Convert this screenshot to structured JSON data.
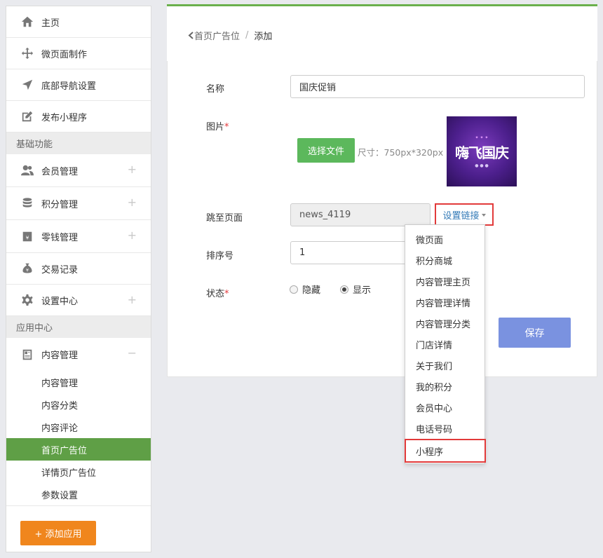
{
  "sidebar": {
    "items": [
      {
        "label": "主页",
        "icon": "home-icon"
      },
      {
        "label": "微页面制作",
        "icon": "move-icon"
      },
      {
        "label": "底部导航设置",
        "icon": "navigation-arrow-icon"
      },
      {
        "label": "发布小程序",
        "icon": "edit-square-icon"
      }
    ],
    "section_basic": "基础功能",
    "basic_items": [
      {
        "label": "会员管理",
        "icon": "users-icon"
      },
      {
        "label": "积分管理",
        "icon": "database-icon"
      },
      {
        "label": "零钱管理",
        "icon": "wallet-icon"
      },
      {
        "label": "交易记录",
        "icon": "money-bag-icon"
      },
      {
        "label": "设置中心",
        "icon": "gear-icon"
      }
    ],
    "section_app": "应用中心",
    "app_item": {
      "label": "内容管理",
      "icon": "document-icon"
    },
    "sub_items": [
      "内容管理",
      "内容分类",
      "内容评论",
      "首页广告位",
      "详情页广告位",
      "参数设置"
    ],
    "add_app": "+ 添加应用"
  },
  "breadcrumb": {
    "back": "首页广告位",
    "sep": "/",
    "current": "添加"
  },
  "form": {
    "name_label": "名称",
    "name_value": "国庆促销",
    "image_label": "图片",
    "required_mark": "*",
    "file_button": "选择文件",
    "size_hint": "尺寸：750px*320px",
    "banner_text": "嗨飞国庆",
    "jump_label": "跳至页面",
    "jump_value": "news_4119",
    "link_button": "设置链接",
    "sort_label": "排序号",
    "sort_value": "1",
    "status_label": "状态",
    "status_hidden": "隐藏",
    "status_show": "显示",
    "save": "保存"
  },
  "dropdown": [
    "微页面",
    "积分商城",
    "内容管理主页",
    "内容管理详情",
    "内容管理分类",
    "门店详情",
    "关于我们",
    "我的积分",
    "会员中心",
    "电话号码",
    "小程序"
  ],
  "colors": {
    "accent_green": "#5f9f46",
    "add_button": "#f0861d",
    "save_button": "#7a92e0",
    "highlight_red": "#e23a3a"
  }
}
